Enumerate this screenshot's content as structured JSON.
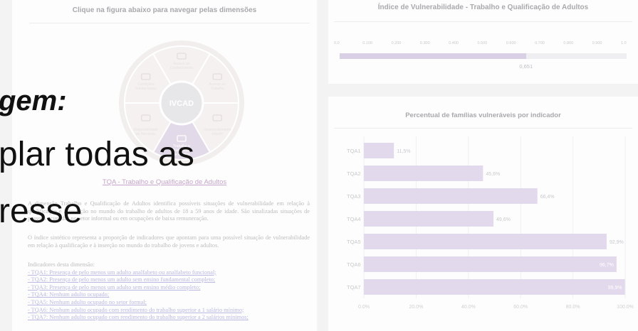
{
  "left_panel": {
    "title": "Clique na figura abaixo para navegar pelas dimensões",
    "wheel": {
      "center": "IVCAD",
      "segments": [
        {
          "label": "Acesso ao Conhecimento",
          "icon": "graduation-cap-icon"
        },
        {
          "label": "Acesso ao Trabalho",
          "icon": "briefcase-icon"
        },
        {
          "label": "Desenvolvimento Infantil",
          "icon": "child-icon"
        },
        {
          "label": "Trabalho e Qualificação de Adultos",
          "icon": "monitor-icon",
          "active": true
        },
        {
          "label": "Disponibilidade de Recursos",
          "icon": "money-icon"
        },
        {
          "label": "Condições Habitacionais",
          "icon": "house-icon"
        }
      ]
    },
    "dimension_title": "TQA - Trabalho e Qualificação de Adultos",
    "paragraph1": "A dimensão Trabalho e Qualificação de Adultos identifica possíveis situações de vulnerabilidade em relação à qualificação e à inserção no mundo do trabalho de adultos de 18 a 59 anos de idade. São sinalizadas situações de pessoas ocupadas no setor informal ou em ocupações de baixa remuneração.",
    "paragraph2": "O índice sintético representa a proporção de indicadores que apontam para uma possível situação de vulnerabilidade em relação à qualificação e à inserção no mundo do trabalho de jovens e adultos.",
    "indicators_heading": "Indicadores desta dimensão:",
    "indicators": [
      "- TQA1: Presença de pelo menos um adulto analfabeto ou analfabeto funcional;",
      "- TQA2: Presença de pelo menos um adulto sem ensino fundamental completo;",
      "- TQA3: Presença de pelo menos um adulto sem ensino médio completo;",
      "- TQA4: Nenhum adulto ocupado;",
      "- TQA5: Nenhum adulto ocupado no setor formal;",
      "- TQA6: Nenhum adulto ocupado com rendimento do trabalho superior a 1 salário mínimo;",
      "- TQA7: Nenhum adulto ocupado com rendimento do trabalho superior a 2 salários mínimos;"
    ]
  },
  "index_panel": {
    "title": "Índice de Vulnerabilidade - Trabalho e Qualificação de Adultos",
    "axis_ticks": [
      "0.0",
      "0.100",
      "0.200",
      "0.300",
      "0.400",
      "0.500",
      "0.600",
      "0.700",
      "0.800",
      "0.900",
      "1.0"
    ],
    "value": 0.651,
    "value_label": "0,651",
    "bar_color": "#d9d0e6"
  },
  "chart_panel": {
    "title": "Percentual de famílias vulneráveis por indicador"
  },
  "chart_data": {
    "type": "bar",
    "orientation": "horizontal",
    "title": "Percentual de famílias vulneráveis por indicador",
    "categories": [
      "TQA1",
      "TQA2",
      "TQA3",
      "TQA4",
      "TQA5",
      "TQA6",
      "TQA7"
    ],
    "values": [
      11.5,
      45.6,
      66.4,
      49.6,
      92.9,
      96.7,
      99.9
    ],
    "value_labels": [
      "11,5%",
      "45,6%",
      "66,4%",
      "49,6%",
      "92,9%",
      "96,7%",
      "99,9%"
    ],
    "x_ticks": [
      "0.0%",
      "20.0%",
      "40.0%",
      "60.0%",
      "80.0%",
      "100.0%"
    ],
    "xlim": [
      0,
      100
    ],
    "grid": true,
    "bar_color": "#e2d9ec"
  },
  "overlay": {
    "line1": "gem:",
    "line2": "plar todas as",
    "line3": "resse"
  }
}
